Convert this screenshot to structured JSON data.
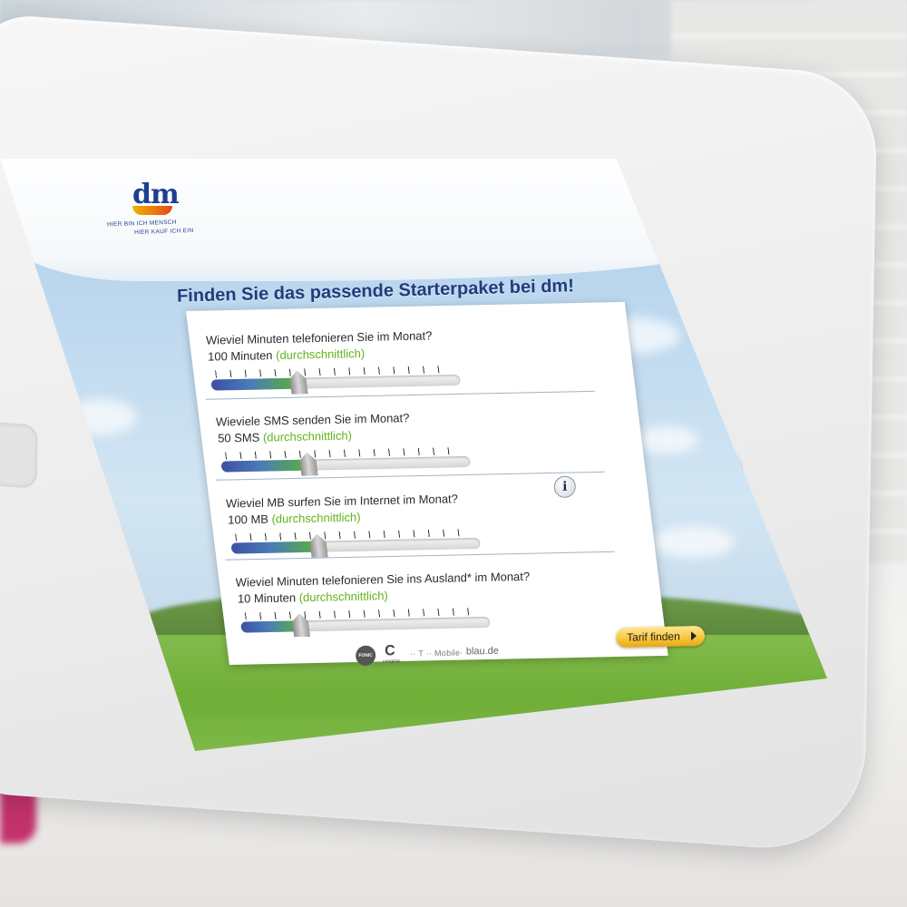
{
  "brand": {
    "logo_text": "dm",
    "tagline_1": "HIER BIN ICH MENSCH",
    "tagline_2": "HIER KAUF ICH EIN"
  },
  "headline": "Finden Sie das passende Starterpaket bei dm!",
  "questions": [
    {
      "label": "Wieviel Minuten telefonieren Sie im Monat?",
      "value": "100 Minuten",
      "note": "(durchschnittlich)",
      "level": 0.35
    },
    {
      "label": "Wieviele SMS senden Sie im Monat?",
      "value": "50 SMS",
      "note": "(durchschnittlich)",
      "level": 0.35
    },
    {
      "label": "Wieviel MB surfen Sie im Internet im Monat?",
      "value": "100 MB",
      "note": "(durchschnittlich)",
      "level": 0.35
    },
    {
      "label": "Wieviel Minuten telefonieren Sie ins Ausland* im Monat?",
      "value": "10 Minuten",
      "note": "(durchschnittlich)",
      "level": 0.24
    }
  ],
  "info_icon": "info-icon",
  "cta_label": "Tarif finden",
  "providers": {
    "fonic": "FONIC",
    "congstar": "C",
    "congstar_sub": "congstar",
    "tmobile": "·· T ·· Mobile·",
    "blau": "blau.de"
  },
  "colors": {
    "accent_blue": "#233b7a",
    "note_green": "#5fb41a",
    "cta_yellow": "#f7c43a"
  }
}
